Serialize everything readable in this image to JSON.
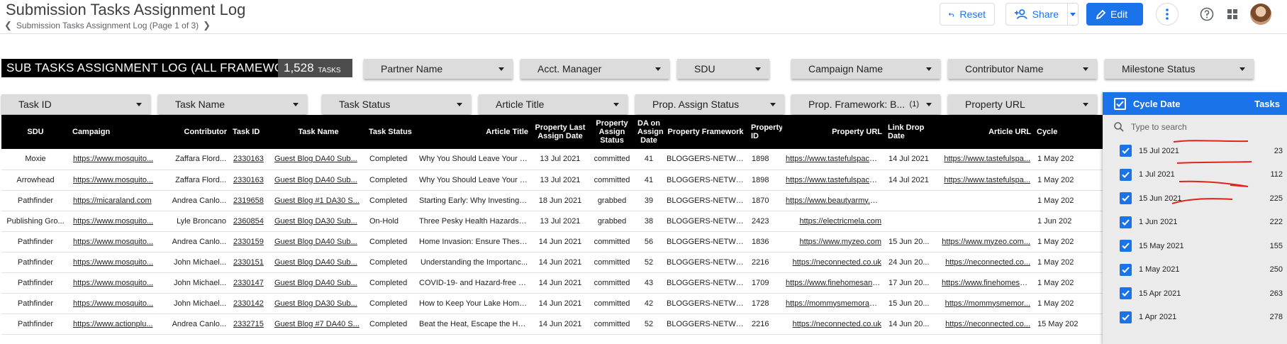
{
  "app": {
    "title": "Submission Tasks Assignment Log",
    "breadcrumb": "Submission Tasks Assignment Log (Page 1 of 3)",
    "buttons": {
      "reset": "Reset",
      "share": "Share",
      "edit": "Edit"
    },
    "icons": {
      "reset": "undo-icon",
      "share": "person-add-icon",
      "edit": "pencil-icon",
      "more": "more-vert-icon",
      "help": "help-icon",
      "apps": "grid-icon"
    }
  },
  "header": {
    "title": "SUB TASKS ASSIGNMENT LOG (ALL FRAMEWORKS)",
    "count": "1,528",
    "count_label": "TASKS"
  },
  "filters_row1": [
    "Partner Name",
    "Acct. Manager",
    "SDU",
    "Campaign Name",
    "Contributor Name",
    "Milestone Status"
  ],
  "filters_row2": [
    {
      "label": "Task ID",
      "count": ""
    },
    {
      "label": "Task Name",
      "count": ""
    },
    {
      "label": "Task Status",
      "count": ""
    },
    {
      "label": "Article Title",
      "count": ""
    },
    {
      "label": "Prop. Assign Status",
      "count": ""
    },
    {
      "label": "Prop. Framework: B...",
      "count": "(1)"
    },
    {
      "label": "Property URL",
      "count": ""
    }
  ],
  "table": {
    "columns": [
      "SDU",
      "Campaign",
      "Contributor",
      "Task ID",
      "Task Name",
      "Task Status",
      "Article Title",
      "Property Last Assign Date",
      "Property Assign Status",
      "DA on Assign Date",
      "Property Framework",
      "Property ID",
      "Property URL",
      "Link Drop Date",
      "Article URL",
      "Cycle"
    ],
    "rows": [
      [
        "Moxie",
        "https://www.mosquito...",
        "Zaffara Flord...",
        "2330163",
        "Guest Blog DA40 Sub...",
        "Completed",
        "Why You Should Leave Your H...",
        "13 Jul 2021",
        "committed",
        "41",
        "BLOGGERS-NETWO...",
        "1898",
        "https://www.tastefulspace.co...",
        "14 Jul 2021",
        "https://www.tastefulspa...",
        "1 May 202"
      ],
      [
        "Arrowhead",
        "https://www.mosquito...",
        "Zaffara Flord...",
        "2330163",
        "Guest Blog DA40 Sub...",
        "Completed",
        "Why You Should Leave Your H...",
        "13 Jul 2021",
        "committed",
        "41",
        "BLOGGERS-NETWO...",
        "1898",
        "https://www.tastefulspace.co...",
        "14 Jul 2021",
        "https://www.tastefulspa...",
        "1 May 202"
      ],
      [
        "Pathfinder",
        "https://micaraland.com",
        "Andrea Canlo...",
        "2319658",
        "Guest Blog #1 DA30 S...",
        "Completed",
        "Starting Early: Why Investing ...",
        "18 Jun 2021",
        "grabbed",
        "39",
        "BLOGGERS-NETWO...",
        "1870",
        "https://www.beautyarmy.com",
        "",
        "",
        "1 May 202"
      ],
      [
        "Publishing Gro...",
        "https://www.mosquito...",
        "Lyle Broncano",
        "2360854",
        "Guest Blog DA30 Sub...",
        "On-Hold",
        "Three Pesky Health Hazards t...",
        "13 Jul 2021",
        "grabbed",
        "38",
        "BLOGGERS-NETWO...",
        "2423",
        "https://electricmela.com",
        "",
        "",
        "1 Jun 202"
      ],
      [
        "Pathfinder",
        "https://www.mosquito...",
        "Andrea Canlo...",
        "2330159",
        "Guest Blog DA40 Sub...",
        "Completed",
        "Home Invasion: Ensure These...",
        "14 Jun 2021",
        "committed",
        "56",
        "BLOGGERS-NETWO...",
        "1836",
        "https://www.myzeo.com",
        "15 Jun 20...",
        "https://www.myzeo.com...",
        "1 May 202"
      ],
      [
        "Pathfinder",
        "https://www.mosquito...",
        "John Michael...",
        "2330151",
        "Guest Blog DA40 Sub...",
        "Completed",
        "Understanding the Importanc...",
        "14 Jun 2021",
        "committed",
        "52",
        "BLOGGERS-NETWO...",
        "2216",
        "https://neconnected.co.uk",
        "24 Jun 20...",
        "https://neconnected.co...",
        "1 May 202"
      ],
      [
        "Pathfinder",
        "https://www.mosquito...",
        "John Michael...",
        "2330147",
        "Guest Blog DA40 Sub...",
        "Completed",
        "COVID-19- and Hazard-free H...",
        "14 Jun 2021",
        "committed",
        "43",
        "BLOGGERS-NETWO...",
        "1709",
        "https://www.finehomesandlivi...",
        "17 Jun 20...",
        "https://www.finehomesa...",
        "1 May 202"
      ],
      [
        "Pathfinder",
        "https://www.mosquito...",
        "John Michael...",
        "2330142",
        "Guest Blog DA30 Sub...",
        "Completed",
        "How to Keep Your Lake Home...",
        "14 Jun 2021",
        "committed",
        "42",
        "BLOGGERS-NETWO...",
        "1728",
        "https://mommysmemorandu...",
        "15 Jun 20...",
        "https://mommysmemor...",
        "1 May 202"
      ],
      [
        "Pathfinder",
        "https://www.actionplu...",
        "Andrea Canlo...",
        "2332715",
        "Guest Blog #7 DA40 S...",
        "Completed",
        "Beat the Heat, Escape the He...",
        "14 Jun 2021",
        "committed",
        "52",
        "BLOGGERS-NETWO...",
        "2216",
        "https://neconnected.co.uk",
        "14 Jun 20...",
        "https://neconnected.co...",
        "15 May 202"
      ]
    ]
  },
  "cycle_dropdown": {
    "header_label": "Cycle Date",
    "header_metric": "Tasks",
    "search_placeholder": "Type to search",
    "options": [
      {
        "label": "15 Jul 2021",
        "count": "23"
      },
      {
        "label": "1 Jul 2021",
        "count": "112"
      },
      {
        "label": "15 Jun 2021",
        "count": "225"
      },
      {
        "label": "1 Jun 2021",
        "count": "222"
      },
      {
        "label": "15 May 2021",
        "count": "155"
      },
      {
        "label": "1 May 2021",
        "count": "250"
      },
      {
        "label": "15 Apr 2021",
        "count": "263"
      },
      {
        "label": "1 Apr 2021",
        "count": "278"
      }
    ],
    "annotation_color": "#e0241b"
  },
  "colors": {
    "accent": "#1a73e8",
    "header_black": "#000000",
    "count_gray": "#4d4d4d",
    "filter_gray": "#dcdcdc"
  }
}
